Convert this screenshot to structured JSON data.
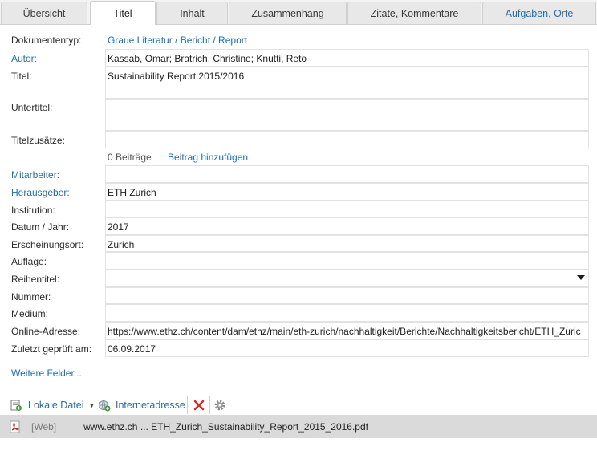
{
  "tabs": [
    {
      "label": "Übersicht"
    },
    {
      "label": "Titel"
    },
    {
      "label": "Inhalt"
    },
    {
      "label": "Zusammenhang"
    },
    {
      "label": "Zitate, Kommentare"
    },
    {
      "label": "Aufgaben, Orte"
    }
  ],
  "form": {
    "dokumententyp_label": "Dokumententyp:",
    "dokumententyp_value": "Graue Literatur / Bericht / Report",
    "autor_label": "Autor:",
    "autor_value": "Kassab, Omar; Bratrich, Christine; Knutti, Reto",
    "titel_label": "Titel:",
    "titel_value": "Sustainability Report 2015/2016",
    "untertitel_label": "Untertitel:",
    "untertitel_value": "",
    "titelzusaetze_label": "Titelzusätze:",
    "titelzusaetze_value": "",
    "beitraege_count": "0 Beiträge",
    "beitrag_add": "Beitrag hinzufügen",
    "mitarbeiter_label": "Mitarbeiter:",
    "mitarbeiter_value": "",
    "herausgeber_label": "Herausgeber:",
    "herausgeber_value": "ETH Zurich",
    "institution_label": "Institution:",
    "institution_value": "",
    "datum_label": "Datum / Jahr:",
    "datum_value": "2017",
    "erscheinungsort_label": "Erscheinungsort:",
    "erscheinungsort_value": "Zurich",
    "auflage_label": "Auflage:",
    "auflage_value": "",
    "reihentitel_label": "Reihentitel:",
    "reihentitel_value": "",
    "nummer_label": "Nummer:",
    "nummer_value": "",
    "medium_label": "Medium:",
    "medium_value": "",
    "online_label": "Online-Adresse:",
    "online_value": "https://www.ethz.ch/content/dam/ethz/main/eth-zurich/nachhaltigkeit/Berichte/Nachhaltigkeitsbericht/ETH_Zuric",
    "geprueft_label": "Zuletzt geprüft am:",
    "geprueft_value": "06.09.2017",
    "weitere_felder": "Weitere Felder..."
  },
  "toolbar": {
    "lokale_datei": "Lokale Datei",
    "internetadresse": "Internetadresse"
  },
  "attachment": {
    "tag": "[Web]",
    "name": "www.ethz.ch ... ETH_Zurich_Sustainability_Report_2015_2016.pdf"
  },
  "colors": {
    "link_blue": "#1a6fb5",
    "delete_red": "#d9262b",
    "pdf_red": "#c9302c"
  }
}
